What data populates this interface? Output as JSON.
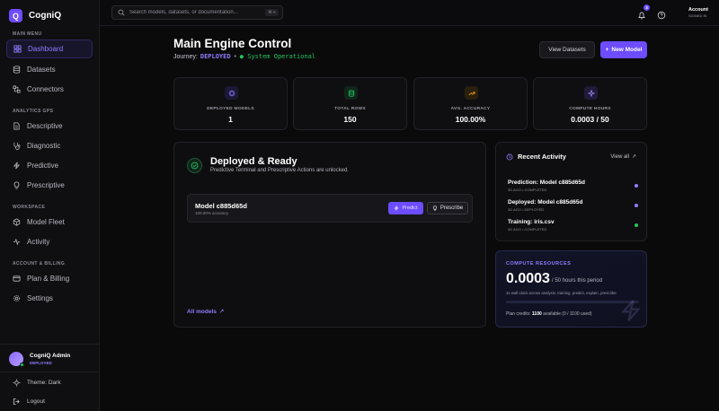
{
  "brand": {
    "logo_letter": "Q",
    "name": "CogniQ",
    "accent": "#6d4dff"
  },
  "sidebar": {
    "sections": {
      "main": "MAIN MENU",
      "analytics": "ANALYTICS GPS",
      "workspace": "WORKSPACE",
      "account": "ACCOUNT & BILLING"
    },
    "items": [
      {
        "label": "Dashboard",
        "icon": "grid-icon",
        "active": true
      },
      {
        "label": "Datasets",
        "icon": "database-icon"
      },
      {
        "label": "Connectors",
        "icon": "plug-icon"
      },
      {
        "label": "Descriptive",
        "icon": "file-icon"
      },
      {
        "label": "Diagnostic",
        "icon": "stethoscope-icon"
      },
      {
        "label": "Predictive",
        "icon": "lightning-icon"
      },
      {
        "label": "Prescriptive",
        "icon": "lightbulb-icon"
      },
      {
        "label": "Model Fleet",
        "icon": "boxes-icon"
      },
      {
        "label": "Activity",
        "icon": "pulse-icon"
      },
      {
        "label": "Plan & Billing",
        "icon": "card-icon"
      },
      {
        "label": "Settings",
        "icon": "gear-icon"
      }
    ],
    "user": {
      "name": "CogniQ Admin",
      "status": "DEPLOYED"
    },
    "theme_label": "Theme: Dark",
    "logout_label": "Logout"
  },
  "topbar": {
    "search_placeholder": "Search models, datasets, or documentation...",
    "shortcut": "⌘ K",
    "notification_count": "3",
    "account_name": "Account",
    "account_status": "SIGNED IN"
  },
  "header": {
    "title": "Main Engine Control",
    "journey_prefix": "Journey:",
    "journey_state": "DEPLOYED",
    "separator": "•",
    "system_status": "● System Operational",
    "view_datasets_label": "View Datasets",
    "new_model_label": "New Model",
    "new_model_icon": "+"
  },
  "stats": [
    {
      "label": "DEPLOYED MODELS",
      "value": "1",
      "icon": "chip-icon",
      "color": "#8f7dff"
    },
    {
      "label": "TOTAL ROWS",
      "value": "150",
      "icon": "database-icon",
      "color": "#22c55e"
    },
    {
      "label": "AVG. ACCURACY",
      "value": "100.00%",
      "icon": "trend-up-icon",
      "color": "#f59e0b"
    },
    {
      "label": "COMPUTE HOURS",
      "value": "0.0003 / 50",
      "icon": "sparkle-icon",
      "color": "#a78bfa"
    }
  ],
  "deployed": {
    "title": "Deployed & Ready",
    "subtitle": "Predictive Terminal and Prescriptive Actions are unlocked.",
    "model": {
      "name": "Model c885d65d",
      "accuracy": "100.00% accuracy"
    },
    "predict_label": "Predict",
    "prescribe_label": "Prescribe",
    "all_models_label": "All models",
    "arrow": "↗"
  },
  "activity": {
    "title": "Recent Activity",
    "view_all_label": "View all",
    "arrow": "↗",
    "items": [
      {
        "title": "Prediction: Model c885d65d",
        "meta": "3D AGO • COMPLETED",
        "color": "#8f7dff"
      },
      {
        "title": "Deployed: Model c885d65d",
        "meta": "3D AGO • DEPLOYED",
        "color": "#8f7dff"
      },
      {
        "title": "Training: iris.csv",
        "meta": "3D AGO • COMPLETED",
        "color": "#22c55e"
      }
    ]
  },
  "compute": {
    "label": "COMPUTE RESOURCES",
    "value": "0.0003",
    "period": "/ 50 hours this period",
    "note": "1s wall-clock across analysis, training, predict, explain, prescribe",
    "usage_fraction": 6e-06,
    "credits_prefix": "Plan credits:",
    "credits_value": "1100",
    "credits_suffix": "available (0 / 1100 used)"
  }
}
